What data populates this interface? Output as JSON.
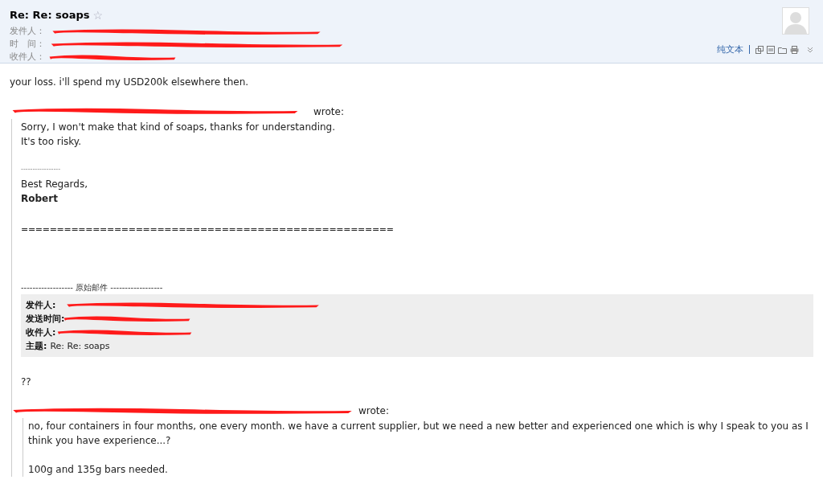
{
  "email": {
    "subject": "Re: Re: soaps",
    "star": "☆",
    "meta": [
      {
        "label": "发件人："
      },
      {
        "label": "时　间："
      },
      {
        "label": "收件人："
      }
    ],
    "toolbar": {
      "plain_text_link": "纯文本"
    }
  },
  "body": {
    "reply": "your loss. i'll spend my USD200k elsewhere then.",
    "quote": {
      "attribution": "wrote:",
      "lines": [
        "Sorry, I won't make that kind of soaps, thanks for understanding.",
        "It's too risky."
      ],
      "separator": "-----------------",
      "closing": "Best Regards,",
      "signature": "Robert",
      "rule": "====================================================",
      "original_header": "------------------ 原始邮件 ------------------",
      "original_fields": [
        {
          "label": "发件人:"
        },
        {
          "label": "发送时间:"
        },
        {
          "label": "收件人:"
        },
        {
          "label": "主题:",
          "value": "Re: Re: soaps"
        }
      ],
      "reply": "??",
      "inner_quote": {
        "attribution": "wrote:",
        "lines": [
          "no, four containers in four months, one every month. we have a current supplier, but we need a new better and experienced one which is why I speak to you as I think you have experience...?",
          "100g and 135g bars needed."
        ]
      }
    }
  }
}
